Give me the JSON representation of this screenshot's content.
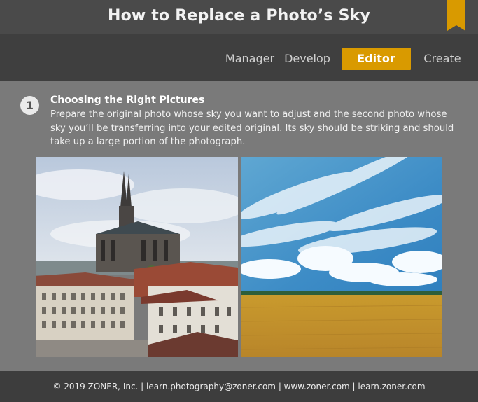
{
  "header": {
    "title": "How to Replace a Photo’s Sky",
    "bookmark_color": "#d99a00"
  },
  "nav": {
    "tabs": [
      {
        "label": "Manager",
        "active": false
      },
      {
        "label": "Develop",
        "active": false
      },
      {
        "label": "Editor",
        "active": true
      },
      {
        "label": "Create",
        "active": false
      }
    ],
    "accent": "#d99a00"
  },
  "step": {
    "number": "1",
    "title": "Choosing the Right Pictures",
    "text": "Prepare the original photo whose sky you want to adjust and the second photo whose sky you’ll be transferring into your edited original. Its sky should be striking and should take up a large portion of the photograph."
  },
  "images": [
    {
      "name": "city-cathedral-photo",
      "description_icon": "cathedral-photo"
    },
    {
      "name": "sky-field-photo",
      "description_icon": "sky-photo"
    }
  ],
  "footer": {
    "text": "© 2019 ZONER, Inc.  |  learn.photography@zoner.com  |  www.zoner.com  |  learn.zoner.com"
  }
}
